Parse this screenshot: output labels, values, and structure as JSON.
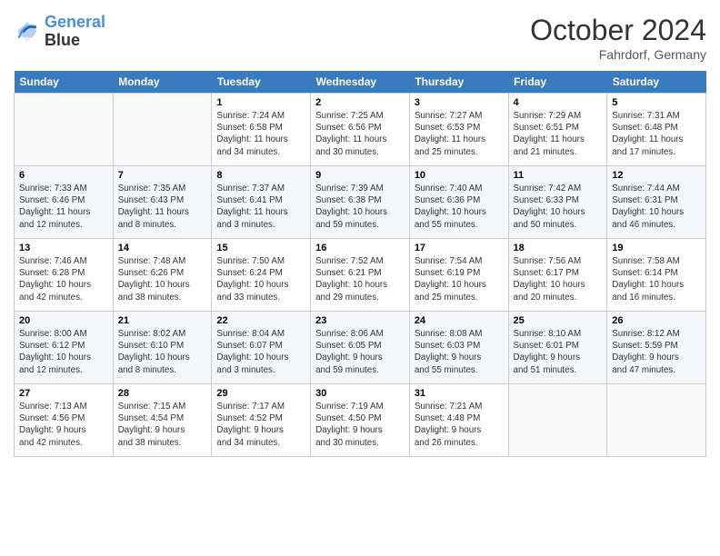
{
  "header": {
    "logo_line1": "General",
    "logo_line2": "Blue",
    "month": "October 2024",
    "location": "Fahrdorf, Germany"
  },
  "weekdays": [
    "Sunday",
    "Monday",
    "Tuesday",
    "Wednesday",
    "Thursday",
    "Friday",
    "Saturday"
  ],
  "weeks": [
    [
      {
        "day": "",
        "info": ""
      },
      {
        "day": "",
        "info": ""
      },
      {
        "day": "1",
        "info": "Sunrise: 7:24 AM\nSunset: 6:58 PM\nDaylight: 11 hours\nand 34 minutes."
      },
      {
        "day": "2",
        "info": "Sunrise: 7:25 AM\nSunset: 6:56 PM\nDaylight: 11 hours\nand 30 minutes."
      },
      {
        "day": "3",
        "info": "Sunrise: 7:27 AM\nSunset: 6:53 PM\nDaylight: 11 hours\nand 25 minutes."
      },
      {
        "day": "4",
        "info": "Sunrise: 7:29 AM\nSunset: 6:51 PM\nDaylight: 11 hours\nand 21 minutes."
      },
      {
        "day": "5",
        "info": "Sunrise: 7:31 AM\nSunset: 6:48 PM\nDaylight: 11 hours\nand 17 minutes."
      }
    ],
    [
      {
        "day": "6",
        "info": "Sunrise: 7:33 AM\nSunset: 6:46 PM\nDaylight: 11 hours\nand 12 minutes."
      },
      {
        "day": "7",
        "info": "Sunrise: 7:35 AM\nSunset: 6:43 PM\nDaylight: 11 hours\nand 8 minutes."
      },
      {
        "day": "8",
        "info": "Sunrise: 7:37 AM\nSunset: 6:41 PM\nDaylight: 11 hours\nand 3 minutes."
      },
      {
        "day": "9",
        "info": "Sunrise: 7:39 AM\nSunset: 6:38 PM\nDaylight: 10 hours\nand 59 minutes."
      },
      {
        "day": "10",
        "info": "Sunrise: 7:40 AM\nSunset: 6:36 PM\nDaylight: 10 hours\nand 55 minutes."
      },
      {
        "day": "11",
        "info": "Sunrise: 7:42 AM\nSunset: 6:33 PM\nDaylight: 10 hours\nand 50 minutes."
      },
      {
        "day": "12",
        "info": "Sunrise: 7:44 AM\nSunset: 6:31 PM\nDaylight: 10 hours\nand 46 minutes."
      }
    ],
    [
      {
        "day": "13",
        "info": "Sunrise: 7:46 AM\nSunset: 6:28 PM\nDaylight: 10 hours\nand 42 minutes."
      },
      {
        "day": "14",
        "info": "Sunrise: 7:48 AM\nSunset: 6:26 PM\nDaylight: 10 hours\nand 38 minutes."
      },
      {
        "day": "15",
        "info": "Sunrise: 7:50 AM\nSunset: 6:24 PM\nDaylight: 10 hours\nand 33 minutes."
      },
      {
        "day": "16",
        "info": "Sunrise: 7:52 AM\nSunset: 6:21 PM\nDaylight: 10 hours\nand 29 minutes."
      },
      {
        "day": "17",
        "info": "Sunrise: 7:54 AM\nSunset: 6:19 PM\nDaylight: 10 hours\nand 25 minutes."
      },
      {
        "day": "18",
        "info": "Sunrise: 7:56 AM\nSunset: 6:17 PM\nDaylight: 10 hours\nand 20 minutes."
      },
      {
        "day": "19",
        "info": "Sunrise: 7:58 AM\nSunset: 6:14 PM\nDaylight: 10 hours\nand 16 minutes."
      }
    ],
    [
      {
        "day": "20",
        "info": "Sunrise: 8:00 AM\nSunset: 6:12 PM\nDaylight: 10 hours\nand 12 minutes."
      },
      {
        "day": "21",
        "info": "Sunrise: 8:02 AM\nSunset: 6:10 PM\nDaylight: 10 hours\nand 8 minutes."
      },
      {
        "day": "22",
        "info": "Sunrise: 8:04 AM\nSunset: 6:07 PM\nDaylight: 10 hours\nand 3 minutes."
      },
      {
        "day": "23",
        "info": "Sunrise: 8:06 AM\nSunset: 6:05 PM\nDaylight: 9 hours\nand 59 minutes."
      },
      {
        "day": "24",
        "info": "Sunrise: 8:08 AM\nSunset: 6:03 PM\nDaylight: 9 hours\nand 55 minutes."
      },
      {
        "day": "25",
        "info": "Sunrise: 8:10 AM\nSunset: 6:01 PM\nDaylight: 9 hours\nand 51 minutes."
      },
      {
        "day": "26",
        "info": "Sunrise: 8:12 AM\nSunset: 5:59 PM\nDaylight: 9 hours\nand 47 minutes."
      }
    ],
    [
      {
        "day": "27",
        "info": "Sunrise: 7:13 AM\nSunset: 4:56 PM\nDaylight: 9 hours\nand 42 minutes."
      },
      {
        "day": "28",
        "info": "Sunrise: 7:15 AM\nSunset: 4:54 PM\nDaylight: 9 hours\nand 38 minutes."
      },
      {
        "day": "29",
        "info": "Sunrise: 7:17 AM\nSunset: 4:52 PM\nDaylight: 9 hours\nand 34 minutes."
      },
      {
        "day": "30",
        "info": "Sunrise: 7:19 AM\nSunset: 4:50 PM\nDaylight: 9 hours\nand 30 minutes."
      },
      {
        "day": "31",
        "info": "Sunrise: 7:21 AM\nSunset: 4:48 PM\nDaylight: 9 hours\nand 26 minutes."
      },
      {
        "day": "",
        "info": ""
      },
      {
        "day": "",
        "info": ""
      }
    ]
  ]
}
